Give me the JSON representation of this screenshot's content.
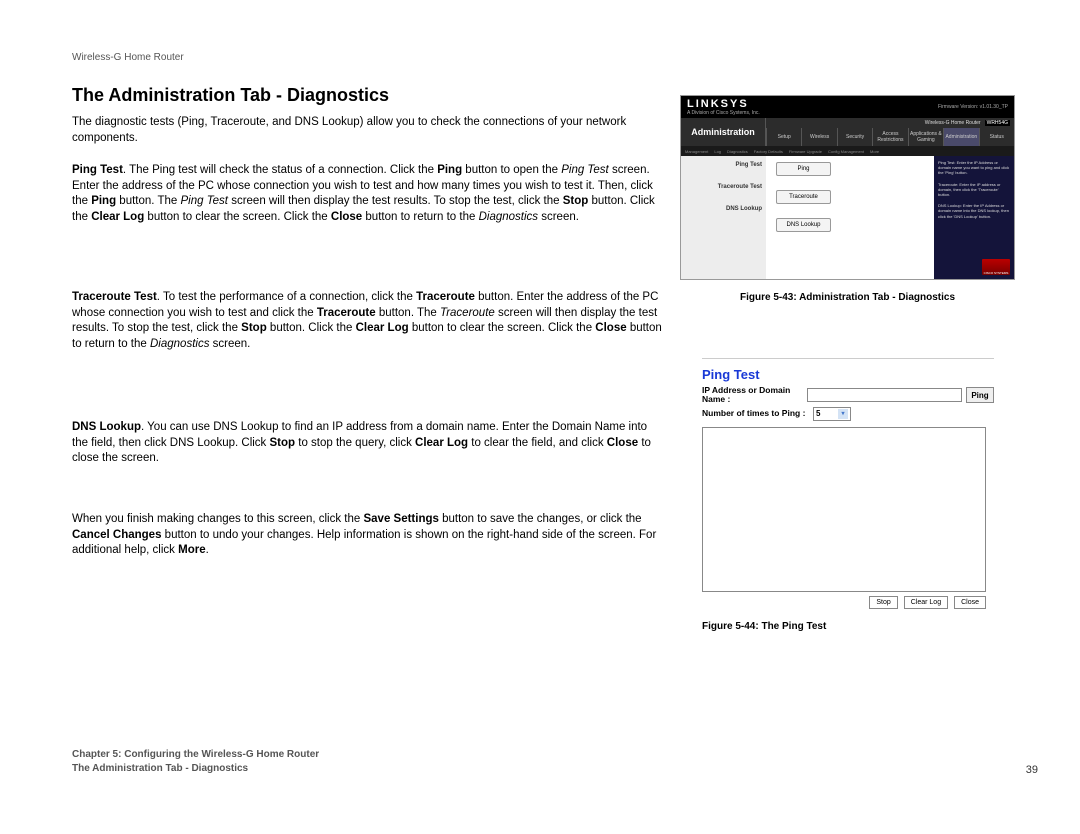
{
  "header": {
    "product": "Wireless-G Home Router"
  },
  "title": "The Administration Tab - Diagnostics",
  "paragraphs": {
    "intro": "The diagnostic tests (Ping, Traceroute, and DNS Lookup) allow you to check the connections of your network components.",
    "ping": {
      "b1": "Ping Test",
      "t1": ". The Ping test will check the status of a connection. Click the ",
      "b2": "Ping",
      "t2": " button to open the ",
      "i1": "Ping Test",
      "t3": " screen. Enter the address of the PC whose connection you wish to test and how many times you wish to test it. Then, click the ",
      "b3": "Ping",
      "t4": " button. The ",
      "i2": "Ping Test",
      "t5": " screen will then display the test results. To stop the test, click the ",
      "b4": "Stop",
      "t6": " button. Click the ",
      "b5": "Clear Log",
      "t7": " button to clear the screen. Click the ",
      "b6": "Close",
      "t8": " button to return to the ",
      "i3": "Diagnostics",
      "t9": " screen."
    },
    "trace": {
      "b1": "Traceroute Test",
      "t1": ". To test the performance of a connection, click the ",
      "b2": "Traceroute",
      "t2": " button. Enter the address of the PC whose connection you wish to test and click the ",
      "b3": "Traceroute",
      "t3": " button. The ",
      "i1": "Traceroute",
      "t4": " screen will then display the test results. To stop the test, click the ",
      "b4": "Stop",
      "t5": " button. Click the ",
      "b5": "Clear Log",
      "t6": " button to clear the screen. Click the ",
      "b6": "Close",
      "t7": " button to return to the ",
      "i2": "Diagnostics",
      "t8": " screen."
    },
    "dns": {
      "b1": "DNS Lookup",
      "t1": ". You can use DNS Lookup to find an IP address from a domain name. Enter the Domain Name into the field, then click DNS Lookup. Click ",
      "b2": "Stop",
      "t2": " to stop the query, click ",
      "b3": "Clear Log",
      "t3": " to clear the field, and click ",
      "b4": "Close",
      "t4": " to close the screen."
    },
    "save": {
      "t1": "When you finish making changes to this screen, click the ",
      "b1": "Save Settings",
      "t2": " button to save the changes, or click the ",
      "b2": "Cancel Changes",
      "t3": " button to undo your changes. Help information is shown on the right-hand side of the screen. For additional help, click ",
      "b3": "More",
      "t4": "."
    }
  },
  "fig1": {
    "logo": "LINKSYS",
    "sublogo": "A Division of Cisco Systems, Inc.",
    "firmware": "Firmware Version: v1.01.30_TP",
    "product_bar": "Wireless-G Home Router",
    "model": "WRH54G",
    "section": "Administration",
    "tabs": [
      "Setup",
      "Wireless",
      "Security",
      "Access Restrictions",
      "Applications & Gaming",
      "Administration",
      "Status"
    ],
    "subtabs": [
      "Management",
      "Log",
      "Diagnostics",
      "Factory Defaults",
      "Firmware Upgrade",
      "Config Management",
      "More"
    ],
    "left_labels": [
      "Ping Test",
      "Traceroute Test",
      "DNS Lookup"
    ],
    "buttons": [
      "Ping",
      "Traceroute",
      "DNS Lookup"
    ],
    "help": {
      "h1": "Ping Test: Enter the IP Address or domain name you want to ping and click the 'Ping' button.",
      "h2": "Traceroute: Enter the IP address or domain, then click the 'Traceroute' button.",
      "h3": "DNS Lookup: Enter the IP Address or domain name into the DNS lookup, then click the 'DNS Lookup' button."
    },
    "cisco": "CISCO SYSTEMS",
    "caption": "Figure 5-43: Administration Tab - Diagnostics"
  },
  "fig2": {
    "title": "Ping Test",
    "label_ip": "IP Address or Domain Name :",
    "label_count": "Number of times to Ping :",
    "ping_button": "Ping",
    "count_value": "5",
    "buttons": [
      "Stop",
      "Clear Log",
      "Close"
    ],
    "caption": "Figure 5-44: The Ping Test"
  },
  "footer": {
    "chapter": "Chapter 5: Configuring the Wireless-G Home Router",
    "section": "The Administration Tab - Diagnostics",
    "page": "39"
  }
}
